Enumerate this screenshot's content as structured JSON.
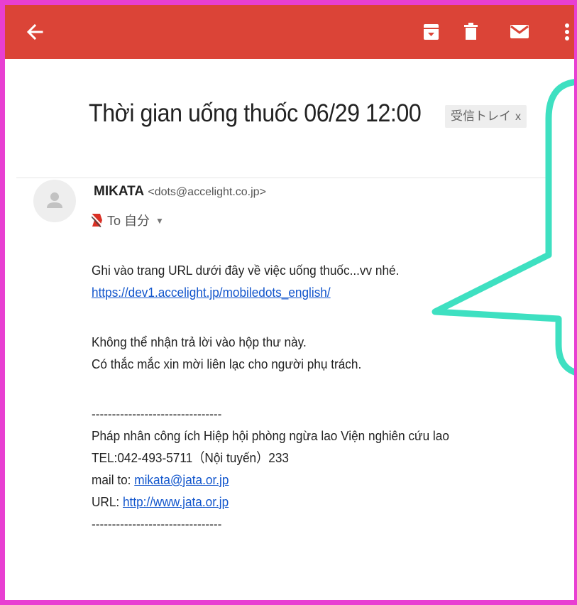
{
  "toolbar": {
    "back_icon": "arrow-back-icon",
    "archive_icon": "archive-icon",
    "delete_icon": "trash-icon",
    "mark_unread_icon": "mail-icon",
    "more_icon": "more-vert-icon",
    "color": "#db4437"
  },
  "email": {
    "subject": "Thời gian uống thuốc 06/29 12:00",
    "label": "受信トレイ",
    "label_close": "x",
    "sender_name": "MIKATA",
    "sender_email": "<dots@accelight.co.jp>",
    "to_label": "To 自分",
    "body": {
      "line1": "Ghi vào trang URL dưới đây về việc uống thuốc...vv nhé.",
      "link1": "https://dev1.accelight.jp/mobiledots_english/",
      "line2": "Không thể nhận trả lời vào hộp thư này.",
      "line3": "Có thắc mắc xin mời liên lạc cho người phụ trách.",
      "separator": "--------------------------------",
      "org": "Pháp nhân công ích Hiệp hội phòng ngừa lao Viện nghiên cứu lao",
      "tel": "TEL:042-493-5711（Nội tuyến）233",
      "mail_prefix": "mail to: ",
      "mail_link": "mikata@jata.or.jp",
      "url_prefix": "URL: ",
      "url_link": "http://www.jata.or.jp",
      "separator_end": "--------------------------------"
    }
  },
  "colors": {
    "frame": "#e83fd2",
    "callout": "#3ee0c1",
    "link": "#1155cc"
  }
}
